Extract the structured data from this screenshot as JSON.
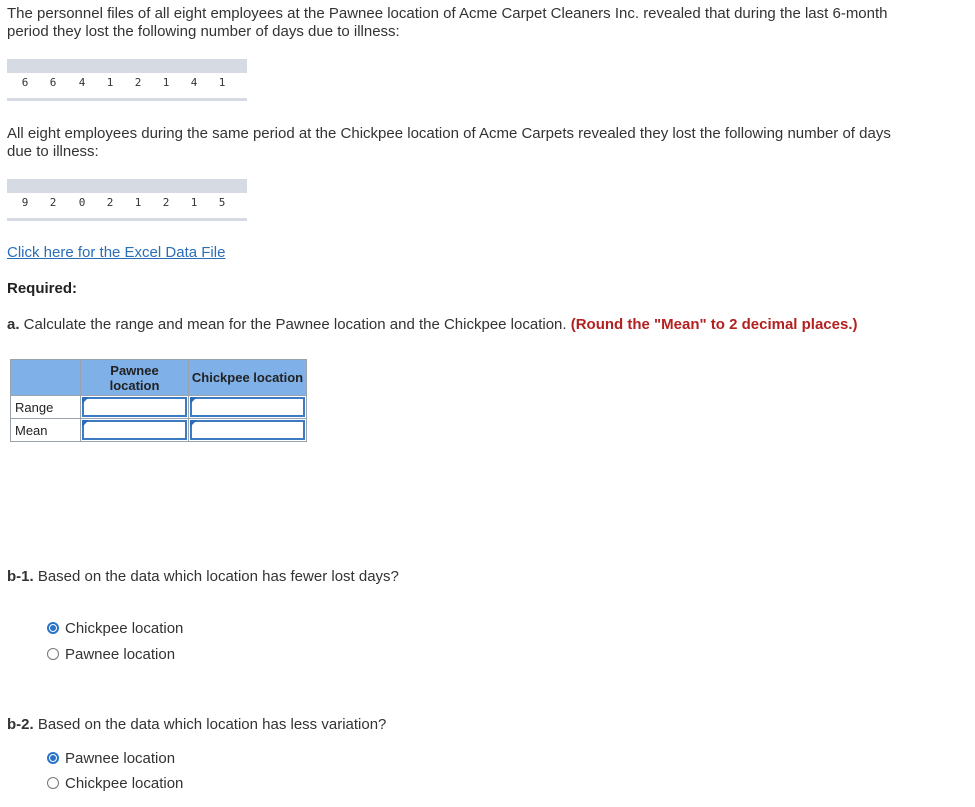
{
  "intro": {
    "line1": "The personnel files of all eight employees at the Pawnee location of Acme Carpet Cleaners Inc. revealed that during the last 6-month",
    "line2": "period they lost the following number of days due to illness:"
  },
  "pawnee_data": [
    "6",
    "6",
    "4",
    "1",
    "2",
    "1",
    "4",
    "1"
  ],
  "chickpee_intro": {
    "line1": "All eight employees during the same period at the Chickpee location of Acme Carpets revealed they lost the following number of days",
    "line2": "due to illness:"
  },
  "chickpee_data": [
    "9",
    "2",
    "0",
    "2",
    "1",
    "2",
    "1",
    "5"
  ],
  "excel_link": "Click here for the Excel Data File",
  "required_label": "Required:",
  "question_a": {
    "prefix": "a.",
    "text": " Calculate the range and mean for the Pawnee location and the Chickpee location. ",
    "note": "(Round the \"Mean\" to 2 decimal places.)"
  },
  "table": {
    "col1_line1": "Pawnee",
    "col1_line2": "location",
    "col2": "Chickpee location",
    "rows": [
      "Range",
      "Mean"
    ],
    "values": {
      "range_pawnee": "",
      "range_chickpee": "",
      "mean_pawnee": "",
      "mean_chickpee": ""
    }
  },
  "question_b1": {
    "prefix": "b-1.",
    "text": " Based on the data which location has fewer lost days?",
    "options": [
      "Chickpee location",
      "Pawnee location"
    ],
    "selected": "Chickpee location"
  },
  "question_b2": {
    "prefix": "b-2.",
    "text": " Based on the data which location has less variation?",
    "options": [
      "Pawnee location",
      "Chickpee location"
    ],
    "selected": "Pawnee location"
  },
  "colors": {
    "header_blue": "#7fb0e8",
    "link_blue": "#2a6eb8",
    "note_red": "#b32020",
    "radio_blue": "#2b73c8"
  }
}
